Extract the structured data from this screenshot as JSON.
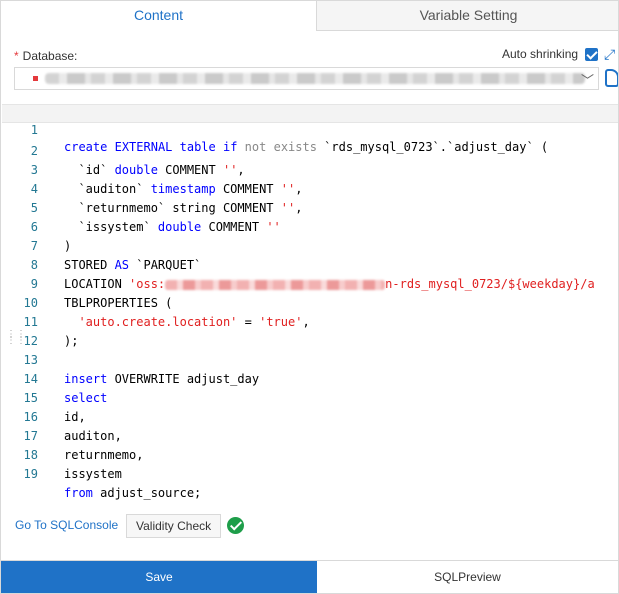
{
  "tabs": [
    {
      "label": "Content",
      "active": true
    },
    {
      "label": "Variable Setting",
      "active": false
    }
  ],
  "database": {
    "label": "Database:",
    "required_mark": "*",
    "auto_shrinking_label": "Auto shrinking",
    "auto_shrinking_checked": true
  },
  "editor": {
    "lines": [
      {
        "n": "1"
      },
      {
        "n": "2"
      },
      {
        "n": "3"
      },
      {
        "n": "4"
      },
      {
        "n": "5"
      },
      {
        "n": "6"
      },
      {
        "n": "7"
      },
      {
        "n": "8"
      },
      {
        "n": "9"
      },
      {
        "n": "10"
      },
      {
        "n": "11"
      },
      {
        "n": "12"
      },
      {
        "n": "13"
      },
      {
        "n": "14"
      },
      {
        "n": "15"
      },
      {
        "n": "16"
      },
      {
        "n": "17"
      },
      {
        "n": "18"
      },
      {
        "n": "19"
      }
    ],
    "tokens": {
      "create": "create",
      "external": "EXTERNAL",
      "table": "table",
      "if": "if",
      "not": "not",
      "exists": "exists",
      "table_name": " `rds_mysql_0723`.`adjust_day` (",
      "l2": "  `id` ",
      "double": "double",
      "comment": " COMMENT ",
      "empty_str": "''",
      "comma": ",",
      "l3": "  `auditon` ",
      "timestamp": "timestamp",
      "l4": "  `returnmemo` string COMMENT ",
      "l5": "  `issystem` ",
      "l6": ")",
      "stored": "STORED ",
      "as": "AS",
      "parquet": " `PARQUET`",
      "location": "LOCATION ",
      "oss_prefix": "'oss:",
      "oss_suffix": "n-rds_mysql_0723/${weekday}/a",
      "tblprops": "TBLPROPERTIES (",
      "prop_key": "'auto.create.location'",
      "eq": " = ",
      "prop_val": "'true'",
      "l11": ");",
      "insert": "insert",
      "overwrite_rest": " OVERWRITE adjust_day",
      "select": "select",
      "l15": "id,",
      "l16": "auditon,",
      "l17": "returnmemo,",
      "l18": "issystem",
      "from": "from",
      "from_rest": " adjust_source;"
    }
  },
  "actions": {
    "goto_label": "Go To SQLConsole",
    "validity_label": "Validity Check",
    "save_label": "Save",
    "preview_label": "SQLPreview"
  },
  "colors": {
    "accent": "#1f72c7",
    "keyword": "#0000ff",
    "string": "#e02020",
    "success": "#1e9e4a"
  }
}
